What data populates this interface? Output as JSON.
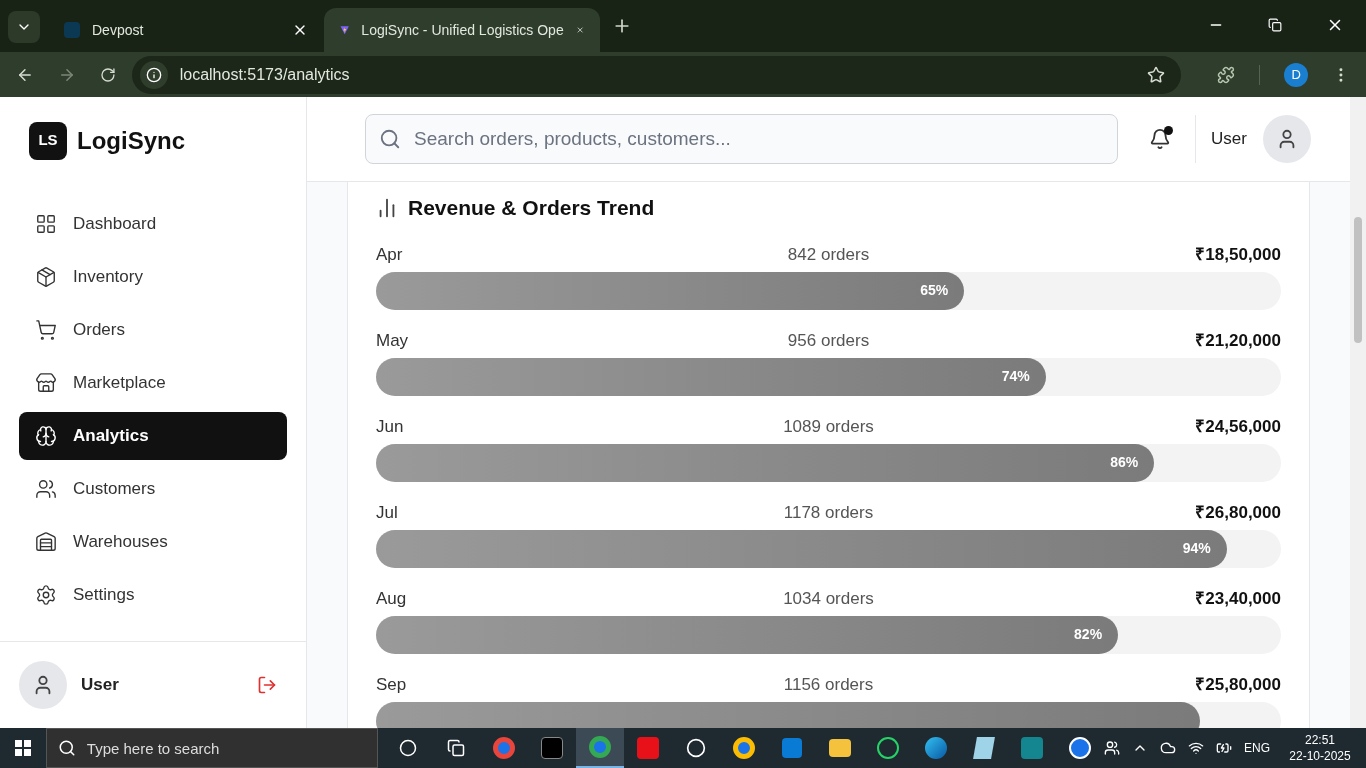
{
  "browser": {
    "tabs": [
      {
        "title": "Devpost",
        "selected": false
      },
      {
        "title": "LogiSync - Unified Logistics Ope",
        "selected": true
      }
    ],
    "url": "localhost:5173/analytics",
    "profile": "D"
  },
  "app": {
    "logo": "LS",
    "name": "LogiSync"
  },
  "nav": [
    {
      "label": "Dashboard",
      "selected": false
    },
    {
      "label": "Inventory",
      "selected": false
    },
    {
      "label": "Orders",
      "selected": false
    },
    {
      "label": "Marketplace",
      "selected": false
    },
    {
      "label": "Analytics",
      "selected": true
    },
    {
      "label": "Customers",
      "selected": false
    },
    {
      "label": "Warehouses",
      "selected": false
    },
    {
      "label": "Settings",
      "selected": false
    }
  ],
  "sidebar_user": "User",
  "header": {
    "search": {
      "placeholder": "Search orders, products, customers..."
    },
    "notification_dot": true,
    "user": "User"
  },
  "chart": {
    "title": "Revenue & Orders Trend",
    "rows": [
      {
        "month": "Apr",
        "orders": "842 orders",
        "revenue": "₹18,50,000",
        "level": 0.65,
        "percent": "65%"
      },
      {
        "month": "May",
        "orders": "956 orders",
        "revenue": "₹21,20,000",
        "level": 0.74,
        "percent": "74%"
      },
      {
        "month": "Jun",
        "orders": "1089 orders",
        "revenue": "₹24,56,000",
        "level": 0.86,
        "percent": "86%"
      },
      {
        "month": "Jul",
        "orders": "1178 orders",
        "revenue": "₹26,80,000",
        "level": 0.94,
        "percent": "94%"
      },
      {
        "month": "Aug",
        "orders": "1034 orders",
        "revenue": "₹23,40,000",
        "level": 0.82,
        "percent": "82%"
      },
      {
        "month": "Sep",
        "orders": "1156 orders",
        "revenue": "₹25,80,000",
        "level": 0.91
      }
    ]
  },
  "taskbar": {
    "search": {
      "placeholder": "Type here to search"
    },
    "language": "ENG",
    "time": "22:51",
    "date": "22-10-2025"
  }
}
